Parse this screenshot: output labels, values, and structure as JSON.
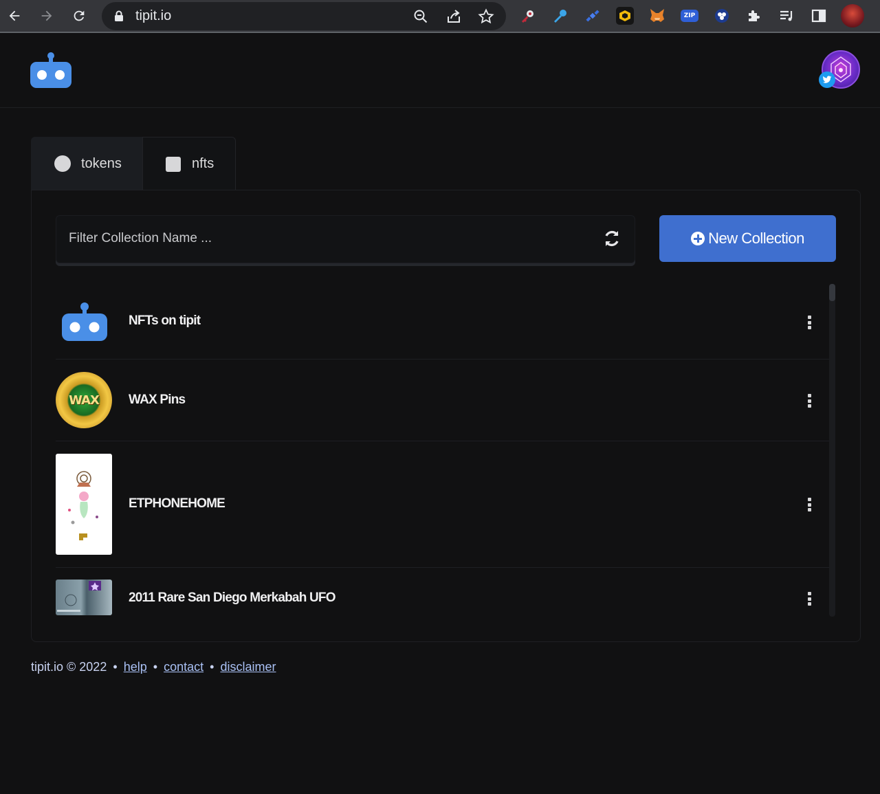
{
  "browser": {
    "url": "tipit.io",
    "extension_zip_label": "ZIP"
  },
  "tabs": [
    {
      "label": "tokens"
    },
    {
      "label": "nfts"
    }
  ],
  "filter": {
    "placeholder": "Filter Collection Name ..."
  },
  "new_collection_label": "New Collection",
  "collections": [
    {
      "name": "NFTs on tipit"
    },
    {
      "name": "WAX Pins",
      "logo_text": "WAX"
    },
    {
      "name": "ETPHONEHOME"
    },
    {
      "name": "2011 Rare San Diego Merkabah UFO"
    }
  ],
  "footer": {
    "copyright": "tipit.io © 2022",
    "links": [
      "help",
      "contact",
      "disclaimer"
    ],
    "separator": "•"
  },
  "colors": {
    "accent": "#3f6fcf",
    "background": "#111112",
    "link": "#a9c0f4",
    "logo": "#4a8fe7"
  }
}
